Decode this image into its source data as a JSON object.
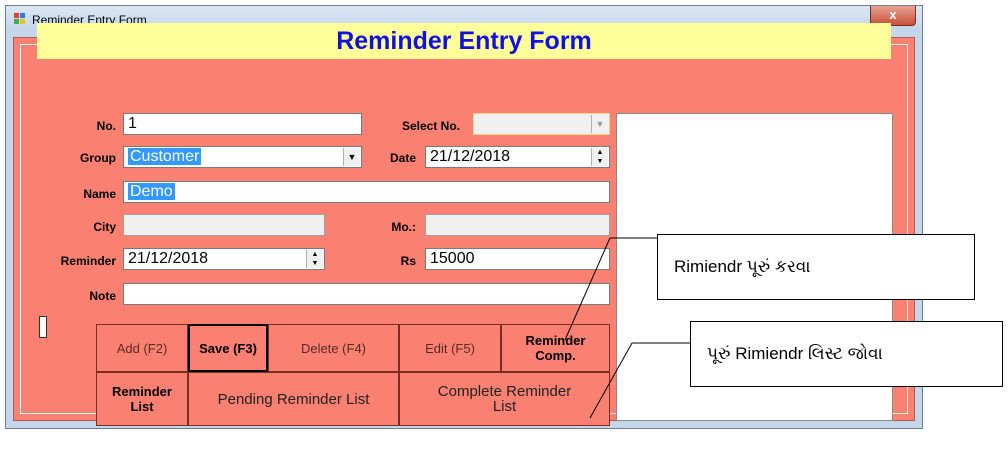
{
  "window": {
    "title": "Reminder Entry Form",
    "close_label": "x"
  },
  "banner": "Reminder Entry Form",
  "form": {
    "no": {
      "label": "No.",
      "value": "1"
    },
    "select_no": {
      "label": "Select No.",
      "value": ""
    },
    "group": {
      "label": "Group",
      "value": "Customer"
    },
    "date": {
      "label": "Date",
      "value": "21/12/2018"
    },
    "name": {
      "label": "Name",
      "value": "Demo"
    },
    "city": {
      "label": "City",
      "value": ""
    },
    "mobile": {
      "label": "Mo.:",
      "value": ""
    },
    "reminder": {
      "label": "Reminder",
      "value": "21/12/2018"
    },
    "rs": {
      "label": "Rs",
      "value": "15000"
    },
    "note": {
      "label": "Note",
      "value": ""
    }
  },
  "buttons": {
    "add": "Add (F2)",
    "save": "Save (F3)",
    "delete": "Delete (F4)",
    "edit": "Edit (F5)",
    "reminder_comp_1": "Reminder",
    "reminder_comp_2": "Comp.",
    "reminder_list_1": "Reminder",
    "reminder_list_2": "List",
    "pending": "Pending Reminder List",
    "complete_1": "Complete Reminder",
    "complete_2": "List"
  },
  "callouts": {
    "complete_reminder": "Rimiendr પૂરું કરવા",
    "view_complete_list": "પૂરું Rimiendr લિસ્ટ જોવા"
  },
  "colors": {
    "form_bg": "#fa8072",
    "banner_bg": "#ffff99",
    "banner_text": "#1010e0"
  }
}
